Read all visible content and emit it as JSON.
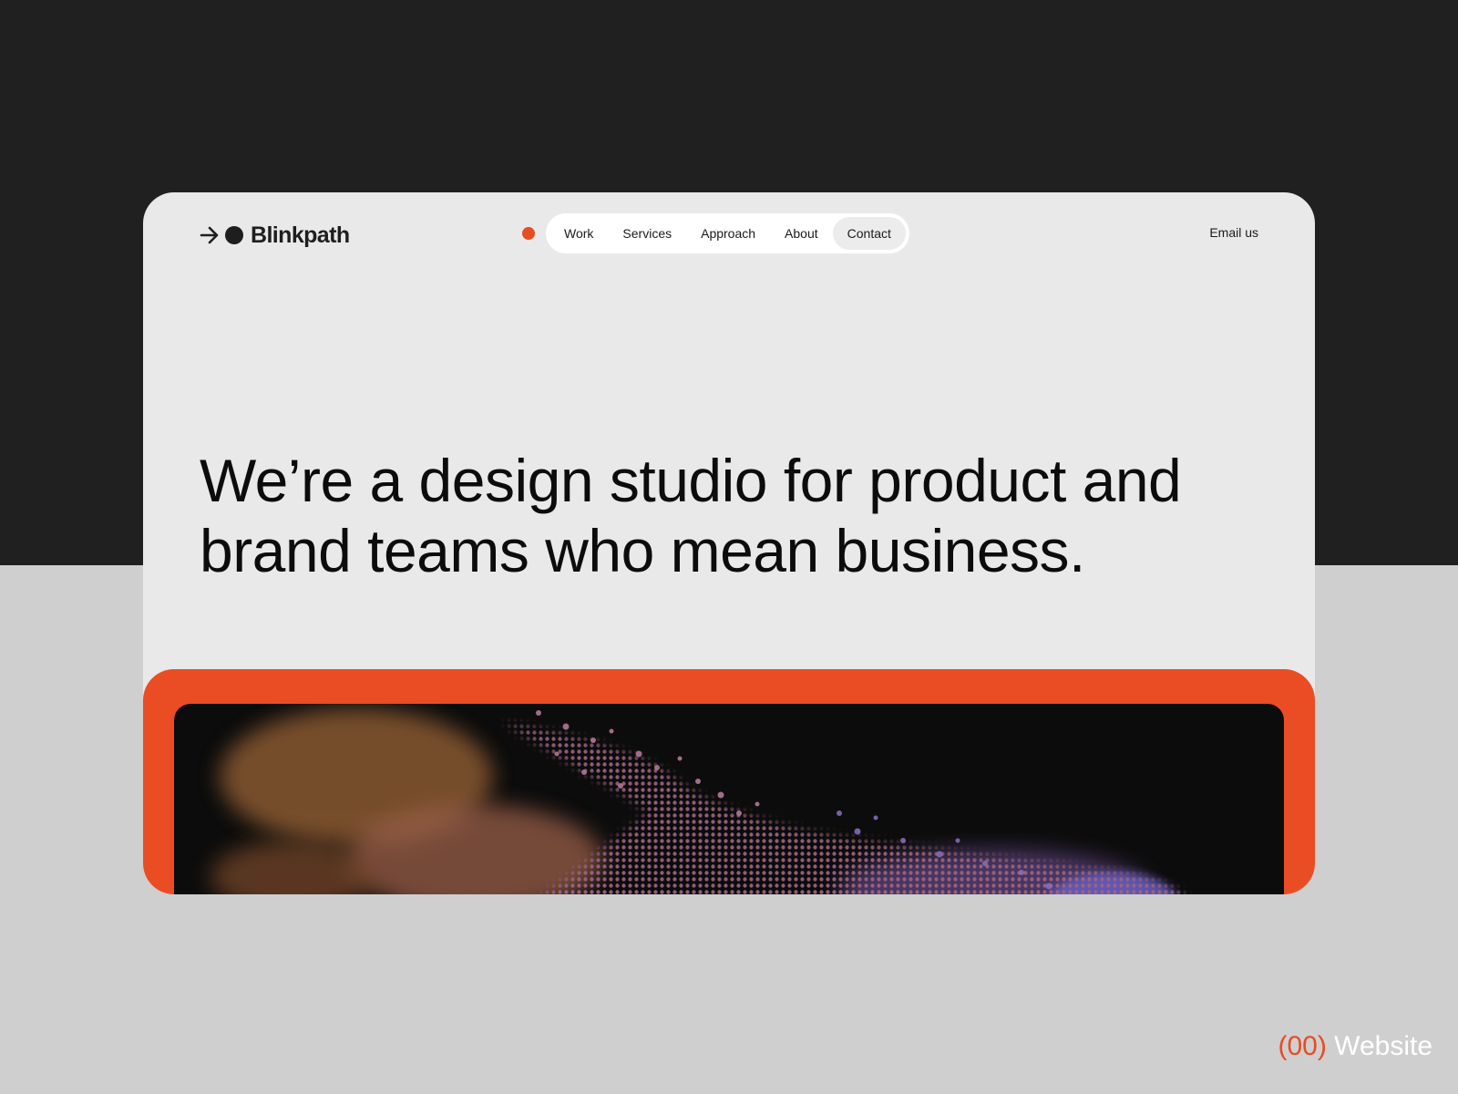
{
  "brand": {
    "name": "Blinkpath",
    "accent_color": "#e84c23",
    "logo_icons": [
      "arrow-right-icon",
      "dot-icon"
    ]
  },
  "nav": {
    "items": [
      {
        "label": "Work"
      },
      {
        "label": "Services"
      },
      {
        "label": "Approach"
      },
      {
        "label": "About"
      },
      {
        "label": "Contact",
        "active": true
      }
    ]
  },
  "email_link": "Email us",
  "hero": {
    "headline": "We’re a design studio for product and brand teams who mean business."
  },
  "showcase": {
    "frame_color": "#ea4d24",
    "image": "abstract particle cloud"
  },
  "caption": {
    "number": "(00)",
    "label": "Website"
  }
}
